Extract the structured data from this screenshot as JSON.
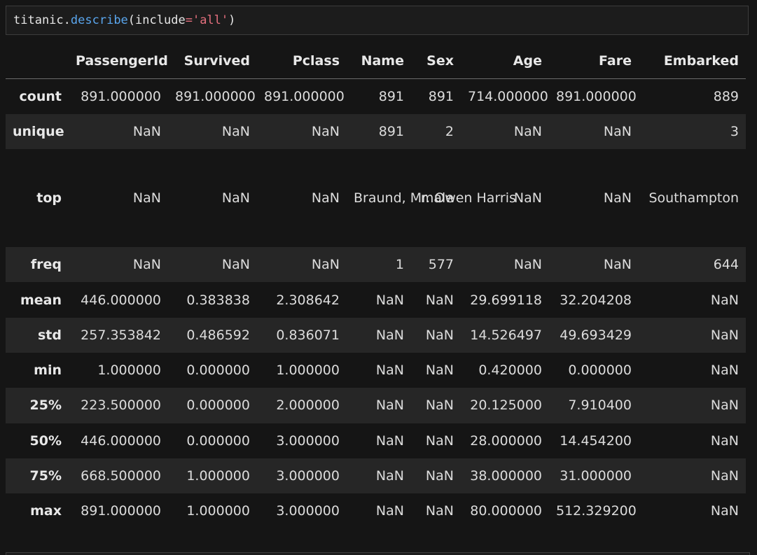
{
  "code_cell": {
    "object": "titanic",
    "dot": ".",
    "method": "describe",
    "open_paren": "(",
    "kwarg": "include",
    "equals": "=",
    "string": "'all'",
    "close_paren": ")"
  },
  "table": {
    "columns": [
      "PassengerId",
      "Survived",
      "Pclass",
      "Name",
      "Sex",
      "Age",
      "Fare",
      "Embarked"
    ],
    "rows": [
      {
        "index": "count",
        "cells": [
          "891.000000",
          "891.000000",
          "891.000000",
          "891",
          "891",
          "714.000000",
          "891.000000",
          "889"
        ]
      },
      {
        "index": "unique",
        "cells": [
          "NaN",
          "NaN",
          "NaN",
          "891",
          "2",
          "NaN",
          "NaN",
          "3"
        ]
      },
      {
        "index": "top",
        "cells": [
          "NaN",
          "NaN",
          "NaN",
          "Braund, Mr. Owen Harris",
          "male",
          "NaN",
          "NaN",
          "Southampton"
        ]
      },
      {
        "index": "freq",
        "cells": [
          "NaN",
          "NaN",
          "NaN",
          "1",
          "577",
          "NaN",
          "NaN",
          "644"
        ]
      },
      {
        "index": "mean",
        "cells": [
          "446.000000",
          "0.383838",
          "2.308642",
          "NaN",
          "NaN",
          "29.699118",
          "32.204208",
          "NaN"
        ]
      },
      {
        "index": "std",
        "cells": [
          "257.353842",
          "0.486592",
          "0.836071",
          "NaN",
          "NaN",
          "14.526497",
          "49.693429",
          "NaN"
        ]
      },
      {
        "index": "min",
        "cells": [
          "1.000000",
          "0.000000",
          "1.000000",
          "NaN",
          "NaN",
          "0.420000",
          "0.000000",
          "NaN"
        ]
      },
      {
        "index": "25%",
        "cells": [
          "223.500000",
          "0.000000",
          "2.000000",
          "NaN",
          "NaN",
          "20.125000",
          "7.910400",
          "NaN"
        ]
      },
      {
        "index": "50%",
        "cells": [
          "446.000000",
          "0.000000",
          "3.000000",
          "NaN",
          "NaN",
          "28.000000",
          "14.454200",
          "NaN"
        ]
      },
      {
        "index": "75%",
        "cells": [
          "668.500000",
          "1.000000",
          "3.000000",
          "NaN",
          "NaN",
          "38.000000",
          "31.000000",
          "NaN"
        ]
      },
      {
        "index": "max",
        "cells": [
          "891.000000",
          "1.000000",
          "3.000000",
          "NaN",
          "NaN",
          "80.000000",
          "512.329200",
          "NaN"
        ]
      }
    ]
  },
  "colors": {
    "background": "#151515",
    "stripe": "#262626",
    "method": "#5aa6ee",
    "string": "#e5707e"
  }
}
